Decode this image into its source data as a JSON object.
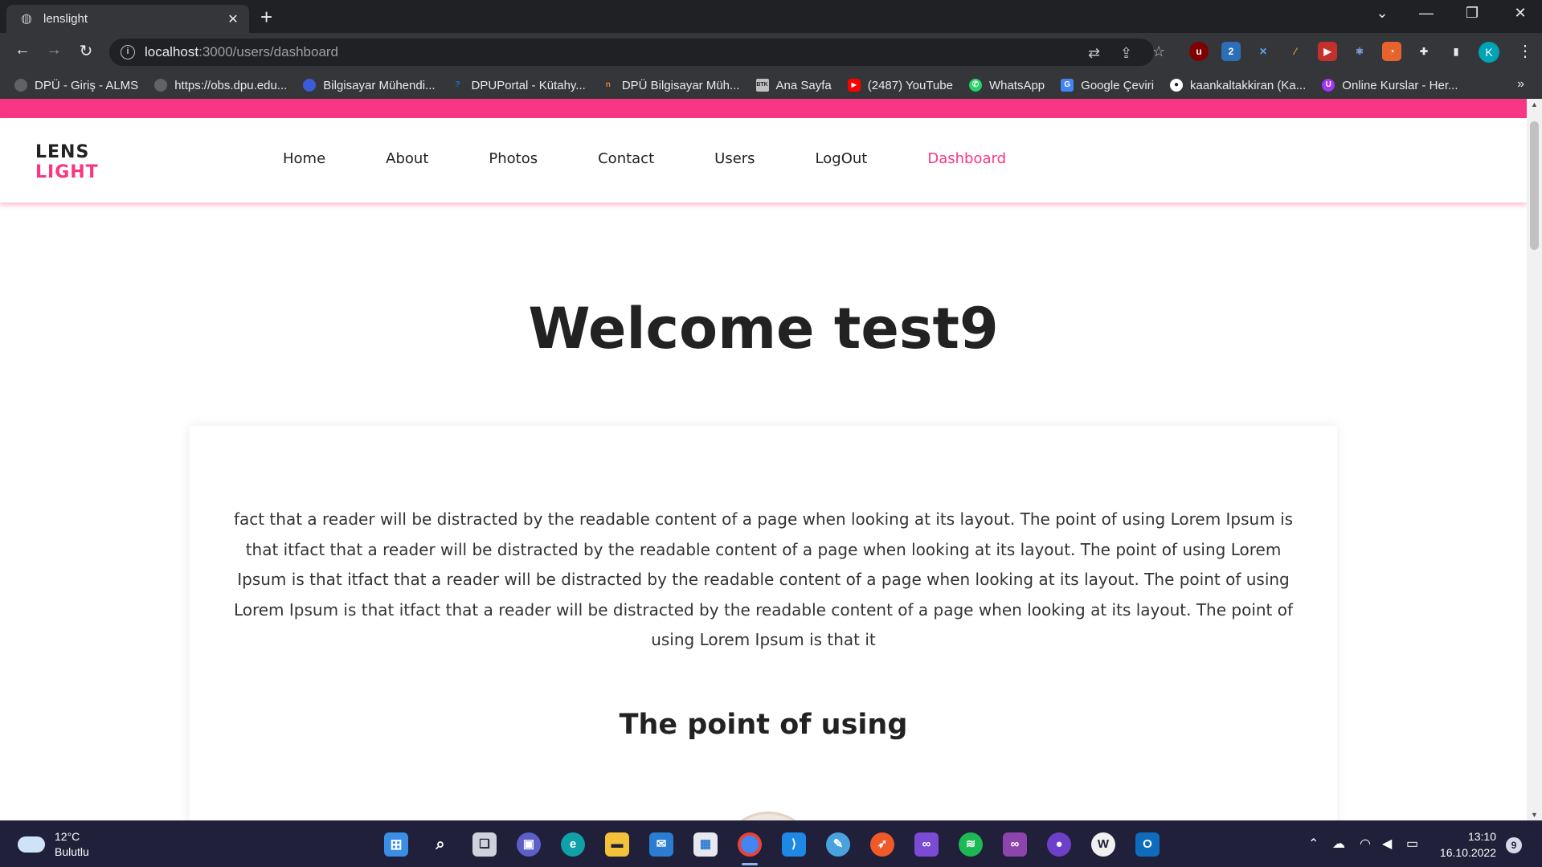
{
  "browser": {
    "tab_title": "lenslight",
    "tab_close_glyph": "✕",
    "new_tab_glyph": "+",
    "window_controls": [
      "⌄",
      "—",
      "❐",
      "✕"
    ],
    "url_host": "localhost",
    "url_path": ":3000/users/dashboard",
    "profile_initial": "K"
  },
  "bookmarks": [
    {
      "label": "DPÜ - Giriş - ALMS",
      "icon": "globe-icon",
      "color": "#5f6368"
    },
    {
      "label": "https://obs.dpu.edu...",
      "icon": "globe-icon",
      "color": "#5f6368"
    },
    {
      "label": "Bilgisayar Mühendi...",
      "icon": "firefox-like-icon",
      "color": "#3b5bdb"
    },
    {
      "label": "DPUPortal - Kütahy...",
      "icon": "portal-icon",
      "color": "#1e6fd9"
    },
    {
      "label": "DPÜ Bilgisayar Müh...",
      "icon": "dpu-icon",
      "color": "#e67e22"
    },
    {
      "label": "Ana Sayfa",
      "icon": "btk-icon",
      "color": "#c0c0c0"
    },
    {
      "label": "(2487) YouTube",
      "icon": "youtube-icon",
      "color": "#ff0000"
    },
    {
      "label": "WhatsApp",
      "icon": "whatsapp-icon",
      "color": "#25d366"
    },
    {
      "label": "Google Çeviri",
      "icon": "translate-icon",
      "color": "#4285f4"
    },
    {
      "label": "kaankaltakkiran (Ka...",
      "icon": "github-icon",
      "color": "#ffffff"
    },
    {
      "label": "Online Kurslar - Her...",
      "icon": "udemy-icon",
      "color": "#a435f0"
    }
  ],
  "site": {
    "logo_line1": "LENS",
    "logo_line2": "LIGHT",
    "nav": [
      "Home",
      "About",
      "Photos",
      "Contact",
      "Users",
      "LogOut",
      "Dashboard"
    ],
    "welcome": "Welcome test9",
    "card_text": "fact that a reader will be distracted by the readable content of a page when looking at its layout. The point of using Lorem Ipsum is that itfact that a reader will be distracted by the readable content of a page when looking at its layout. The point of using Lorem Ipsum is that itfact that a reader will be distracted by the readable content of a page when looking at its layout. The point of using Lorem Ipsum is that itfact that a reader will be distracted by the readable content of a page when looking at its layout. The point of using Lorem Ipsum is that it",
    "card_heading": "The point of using",
    "accent_color": "#f93684"
  },
  "taskbar": {
    "temperature": "12°C",
    "weather": "Bulutlu",
    "time": "13:10",
    "date": "16.10.2022",
    "notifications": "9"
  }
}
